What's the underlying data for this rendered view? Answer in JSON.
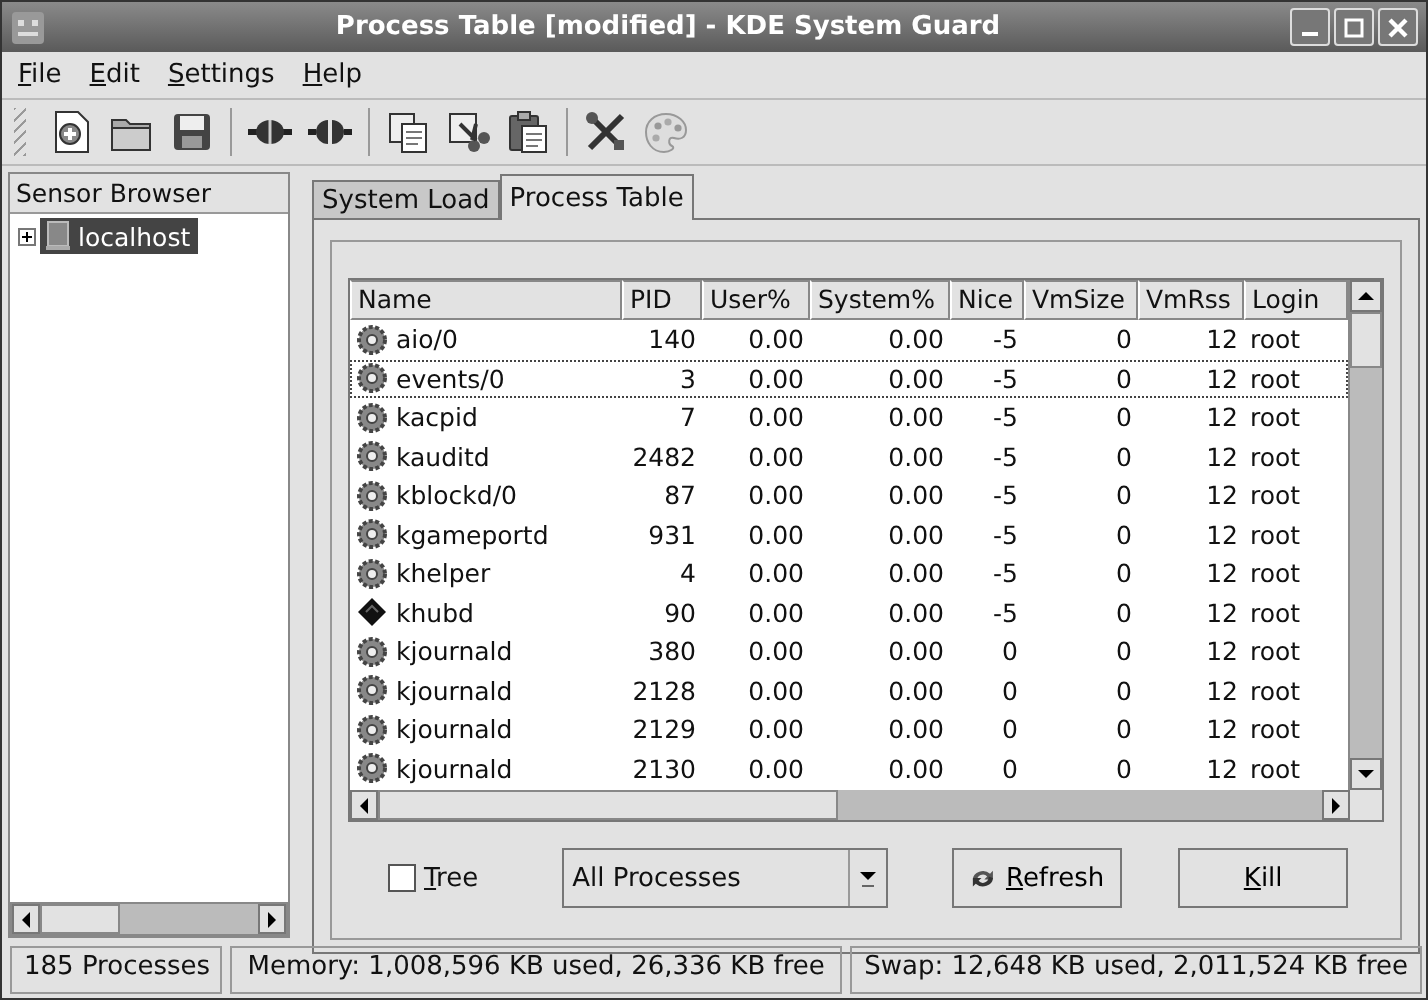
{
  "window": {
    "title": "Process Table [modified] - KDE System Guard"
  },
  "menu": [
    {
      "label": "File",
      "mnemonic": true
    },
    {
      "label": "Edit",
      "mnemonic": true
    },
    {
      "label": "Settings",
      "mnemonic": true
    },
    {
      "label": "Help",
      "mnemonic": true
    }
  ],
  "toolbar": [
    {
      "kind": "new"
    },
    {
      "kind": "open"
    },
    {
      "kind": "save"
    },
    {
      "kind": "sep"
    },
    {
      "kind": "connect"
    },
    {
      "kind": "disconnect"
    },
    {
      "kind": "sep"
    },
    {
      "kind": "copy"
    },
    {
      "kind": "cut"
    },
    {
      "kind": "paste"
    },
    {
      "kind": "sep"
    },
    {
      "kind": "tools"
    },
    {
      "kind": "palette"
    }
  ],
  "sensor_browser": {
    "title": "Sensor Browser",
    "items": [
      {
        "label": "localhost",
        "selected": true,
        "expanded": false
      }
    ]
  },
  "tabs": [
    {
      "label": "System Load",
      "selected": false
    },
    {
      "label": "Process Table",
      "selected": true
    }
  ],
  "table": {
    "columns": [
      "Name",
      "PID",
      "User%",
      "System%",
      "Nice",
      "VmSize",
      "VmRss",
      "Login"
    ],
    "rows": [
      {
        "kind": "gear",
        "focused": false,
        "cells": [
          "aio/0",
          "140",
          "0.00",
          "0.00",
          "-5",
          "0",
          "12",
          "root"
        ]
      },
      {
        "kind": "gear",
        "focused": true,
        "cells": [
          "events/0",
          "3",
          "0.00",
          "0.00",
          "-5",
          "0",
          "12",
          "root"
        ]
      },
      {
        "kind": "gear",
        "focused": false,
        "cells": [
          "kacpid",
          "7",
          "0.00",
          "0.00",
          "-5",
          "0",
          "12",
          "root"
        ]
      },
      {
        "kind": "gear",
        "focused": false,
        "cells": [
          "kauditd",
          "2482",
          "0.00",
          "0.00",
          "-5",
          "0",
          "12",
          "root"
        ]
      },
      {
        "kind": "gear",
        "focused": false,
        "cells": [
          "kblockd/0",
          "87",
          "0.00",
          "0.00",
          "-5",
          "0",
          "12",
          "root"
        ]
      },
      {
        "kind": "gear",
        "focused": false,
        "cells": [
          "kgameportd",
          "931",
          "0.00",
          "0.00",
          "-5",
          "0",
          "12",
          "root"
        ]
      },
      {
        "kind": "gear",
        "focused": false,
        "cells": [
          "khelper",
          "4",
          "0.00",
          "0.00",
          "-5",
          "0",
          "12",
          "root"
        ]
      },
      {
        "kind": "chip",
        "focused": false,
        "cells": [
          "khubd",
          "90",
          "0.00",
          "0.00",
          "-5",
          "0",
          "12",
          "root"
        ]
      },
      {
        "kind": "gear",
        "focused": false,
        "cells": [
          "kjournald",
          "380",
          "0.00",
          "0.00",
          "0",
          "0",
          "12",
          "root"
        ]
      },
      {
        "kind": "gear",
        "focused": false,
        "cells": [
          "kjournald",
          "2128",
          "0.00",
          "0.00",
          "0",
          "0",
          "12",
          "root"
        ]
      },
      {
        "kind": "gear",
        "focused": false,
        "cells": [
          "kjournald",
          "2129",
          "0.00",
          "0.00",
          "0",
          "0",
          "12",
          "root"
        ]
      },
      {
        "kind": "gear",
        "focused": false,
        "cells": [
          "kjournald",
          "2130",
          "0.00",
          "0.00",
          "0",
          "0",
          "12",
          "root"
        ]
      }
    ]
  },
  "controls": {
    "tree": {
      "label": "Tree",
      "checked": false,
      "mnemonic": true
    },
    "filter": {
      "value": "All Processes"
    },
    "buttons": [
      {
        "kind": "refresh",
        "label": "Refresh",
        "mnemonic": true
      },
      {
        "kind": "plain",
        "label": "Kill",
        "mnemonic": true
      }
    ]
  },
  "status_bar": [
    "185 Processes",
    "Memory: 1,008,596 KB used, 26,336 KB free",
    "Swap: 12,648 KB used, 2,011,524 KB free"
  ]
}
